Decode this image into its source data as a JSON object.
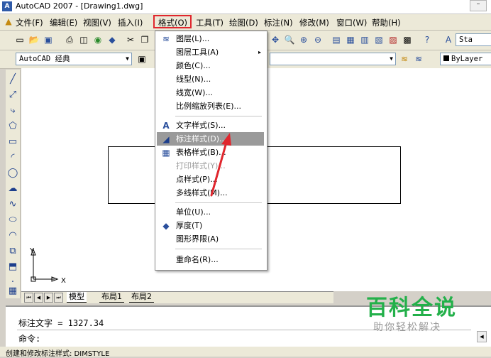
{
  "window": {
    "title": "AutoCAD 2007 - [Drawing1.dwg]",
    "app_icon": "autocad-logo-icon"
  },
  "menubar": {
    "items": [
      {
        "label": "文件(F)"
      },
      {
        "label": "编辑(E)"
      },
      {
        "label": "视图(V)"
      },
      {
        "label": "插入(I)"
      },
      {
        "label": "格式(O)"
      },
      {
        "label": "工具(T)"
      },
      {
        "label": "绘图(D)"
      },
      {
        "label": "标注(N)"
      },
      {
        "label": "修改(M)"
      },
      {
        "label": "窗口(W)"
      },
      {
        "label": "帮助(H)"
      }
    ]
  },
  "toolbar2": {
    "workspace": "AutoCAD 经典",
    "layer": "ByLayer",
    "text_style_partial": "Sta"
  },
  "format_menu": {
    "items": [
      {
        "label": "图层(L)...",
        "icon": "layers-icon"
      },
      {
        "label": "图层工具(A)",
        "submenu": "▸"
      },
      {
        "label": "颜色(C)..."
      },
      {
        "label": "线型(N)..."
      },
      {
        "label": "线宽(W)..."
      },
      {
        "label": "比例缩放列表(E)..."
      },
      {
        "label": "文字样式(S)...",
        "icon": "text-style-icon"
      },
      {
        "label": "标注样式(D)...",
        "icon": "dimension-style-icon"
      },
      {
        "label": "表格样式(B)...",
        "icon": "table-style-icon"
      },
      {
        "label": "打印样式(Y)..."
      },
      {
        "label": "点样式(P)..."
      },
      {
        "label": "多线样式(M)..."
      },
      {
        "label": "单位(U)..."
      },
      {
        "label": "厚度(T)",
        "icon": "thickness-icon"
      },
      {
        "label": "图形界限(A)"
      },
      {
        "label": "重命名(R)..."
      }
    ]
  },
  "tabs": {
    "model": "模型",
    "layout1": "布局1",
    "layout2": "布局2"
  },
  "ucs": {
    "x": "X",
    "y": "Y"
  },
  "command": {
    "line1": "标注文字 = 1327.34",
    "line2": "命令:"
  },
  "status": {
    "text": "创建和修改标注样式:   DIMSTYLE"
  },
  "watermark": {
    "title": "百科全说",
    "subtitle": "助你轻松解决"
  },
  "colors": {
    "highlight_box": "#e0262d",
    "watermark_green": "#23b04a",
    "menu_highlight": "#9a9a9a"
  }
}
